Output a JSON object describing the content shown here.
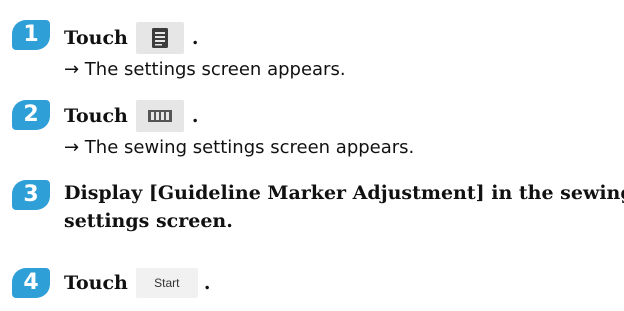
{
  "steps": [
    {
      "number": "1",
      "instruction_prefix": "Touch",
      "button_icon": "settings-list-icon",
      "instruction_suffix": ".",
      "result": "→ The settings screen appears."
    },
    {
      "number": "2",
      "instruction_prefix": "Touch",
      "button_icon": "sewing-settings-icon",
      "instruction_suffix": ".",
      "result": "→ The sewing settings screen appears."
    },
    {
      "number": "3",
      "instruction_line1": "Display [Guideline Marker Adjustment] in the sewing",
      "instruction_line2": "settings screen."
    },
    {
      "number": "4",
      "instruction_prefix": "Touch",
      "button_label": "Start",
      "instruction_suffix": "."
    }
  ],
  "colors": {
    "badge": "#2f9fd7",
    "button_bg": "#e6e6e6",
    "text": "#111111"
  }
}
